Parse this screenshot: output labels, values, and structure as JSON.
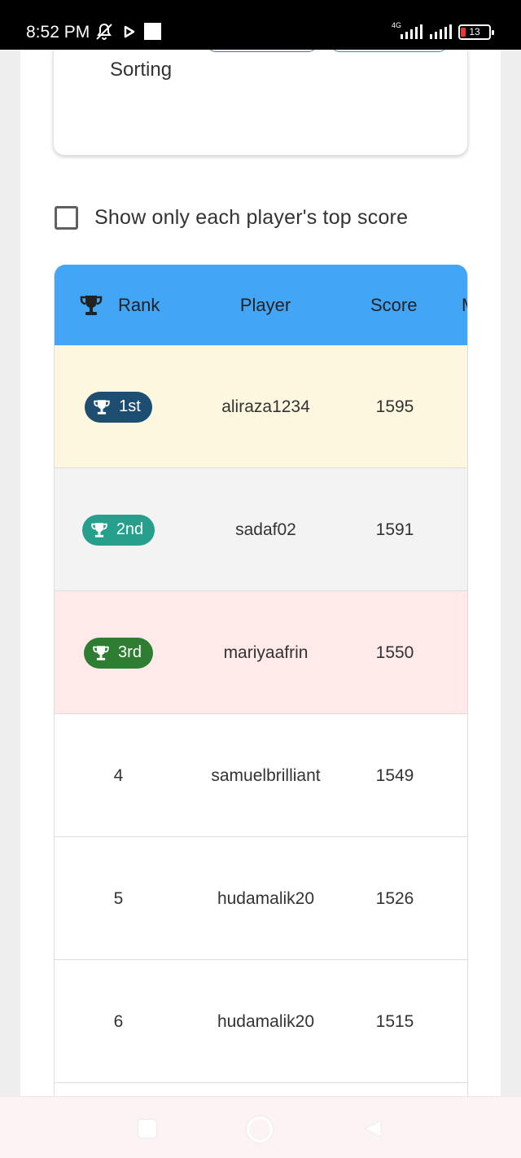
{
  "status_bar": {
    "time": "8:52 PM",
    "network_label": "4G",
    "battery_level": "13",
    "icons": [
      "bell-off-icon",
      "play-icon",
      "notification-square-icon",
      "signal-icon",
      "signal-icon",
      "battery-icon"
    ]
  },
  "sorting_card": {
    "label": "Sorting"
  },
  "filter": {
    "checkbox_label": "Show only each player's top score",
    "checked": false
  },
  "table": {
    "headers": {
      "rank": "Rank",
      "player": "Player",
      "score": "Score",
      "more": "M"
    },
    "header_color": "#42a5f5",
    "rows": [
      {
        "rank": "1st",
        "player": "aliraza1234",
        "score": "1595",
        "badge_color": "#1d4e72",
        "row_color": "#fdf7e0"
      },
      {
        "rank": "2nd",
        "player": "sadaf02",
        "score": "1591",
        "badge_color": "#26a08d",
        "row_color": "#f3f3f3"
      },
      {
        "rank": "3rd",
        "player": "mariyaafrin",
        "score": "1550",
        "badge_color": "#2e7d32",
        "row_color": "#ffe9e9"
      },
      {
        "rank": "4",
        "player": "samuelbrilliant",
        "score": "1549",
        "row_color": "#ffffff"
      },
      {
        "rank": "5",
        "player": "hudamalik20",
        "score": "1526",
        "row_color": "#ffffff"
      },
      {
        "rank": "6",
        "player": "hudamalik20",
        "score": "1515",
        "row_color": "#ffffff"
      }
    ]
  },
  "nav_bar": {
    "icons": [
      "recent-apps-icon",
      "home-icon",
      "back-icon"
    ]
  }
}
